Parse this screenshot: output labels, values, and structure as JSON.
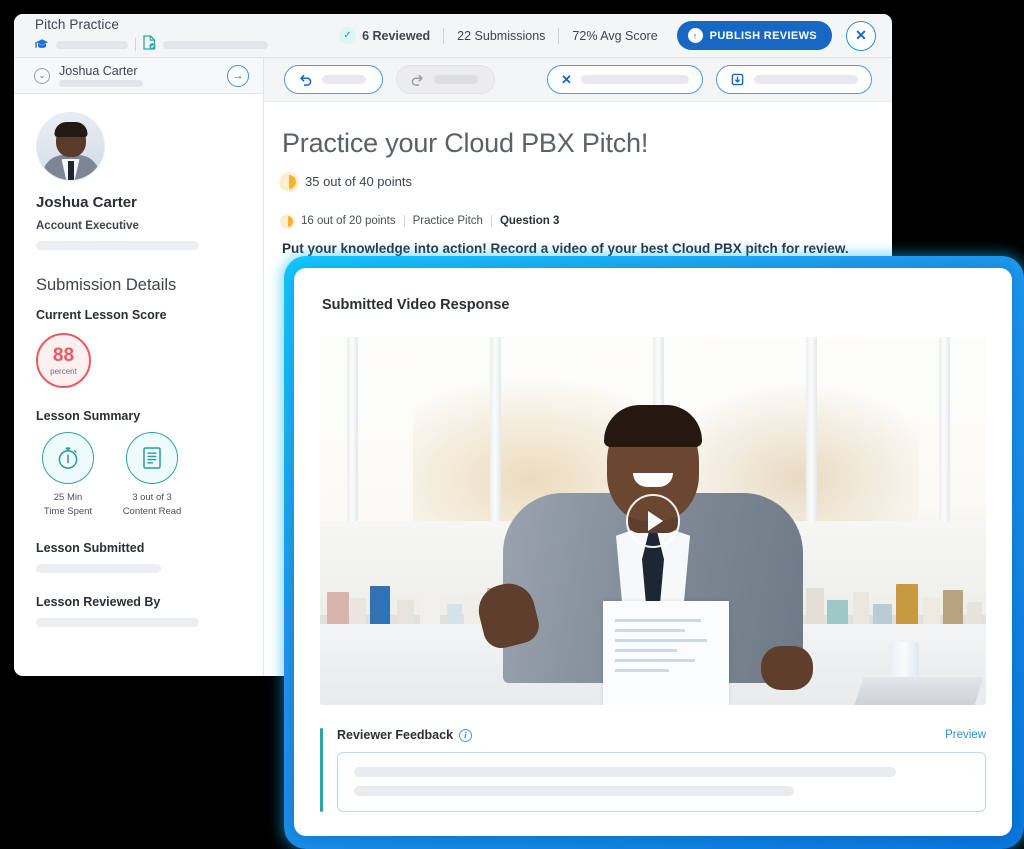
{
  "header": {
    "title": "Pitch Practice",
    "cap_icon": "graduation-cap-icon",
    "doc_icon": "document-check-icon",
    "reviewed": "6 Reviewed",
    "submissions": "22 Submissions",
    "avg_score": "72% Avg Score",
    "publish_label": "PUBLISH REVIEWS",
    "close_label": "✕",
    "check_glyph": "✓",
    "publish_glyph": "↑"
  },
  "sidebar": {
    "student_row_name": "Joshua Carter",
    "chevron_glyph": "⌄",
    "arrow_glyph": "→",
    "person_name": "Joshua Carter",
    "person_role": "Account Executive",
    "section_title": "Submission Details",
    "current_score_label": "Current Lesson Score",
    "score_value": "88",
    "score_unit": "percent",
    "summary_label": "Lesson Summary",
    "summary_items": [
      {
        "icon": "stopwatch-icon",
        "line1": "25 Min",
        "line2": "Time Spent"
      },
      {
        "icon": "document-icon",
        "line1": "3 out of 3",
        "line2": "Content Read"
      }
    ],
    "submitted_label": "Lesson Submitted",
    "reviewed_by_label": "Lesson Reviewed By"
  },
  "toolbar": {
    "undo_icon": "undo-icon",
    "redo_icon": "redo-icon",
    "reject_icon": "reject-x-icon",
    "save_icon": "save-download-icon"
  },
  "main": {
    "lesson_title": "Practice your Cloud PBX Pitch!",
    "total_points": "35 out of 40 points",
    "question_points": "16 out of 20 points",
    "category": "Practice Pitch",
    "question_number": "Question 3",
    "prompt": "Put your knowledge into action! Record a video of your best Cloud PBX pitch for review."
  },
  "modal": {
    "title": "Submitted Video Response",
    "play_icon": "play-icon",
    "feedback_title": "Reviewer Feedback",
    "info_icon": "info-icon",
    "info_glyph": "i",
    "preview_label": "Preview"
  },
  "colors": {
    "brand_blue": "#1668c4",
    "accent_cyan": "#13c8ff",
    "teal": "#2fa3a8",
    "score_red": "#f0575e",
    "points_amber": "#f7b32b"
  }
}
